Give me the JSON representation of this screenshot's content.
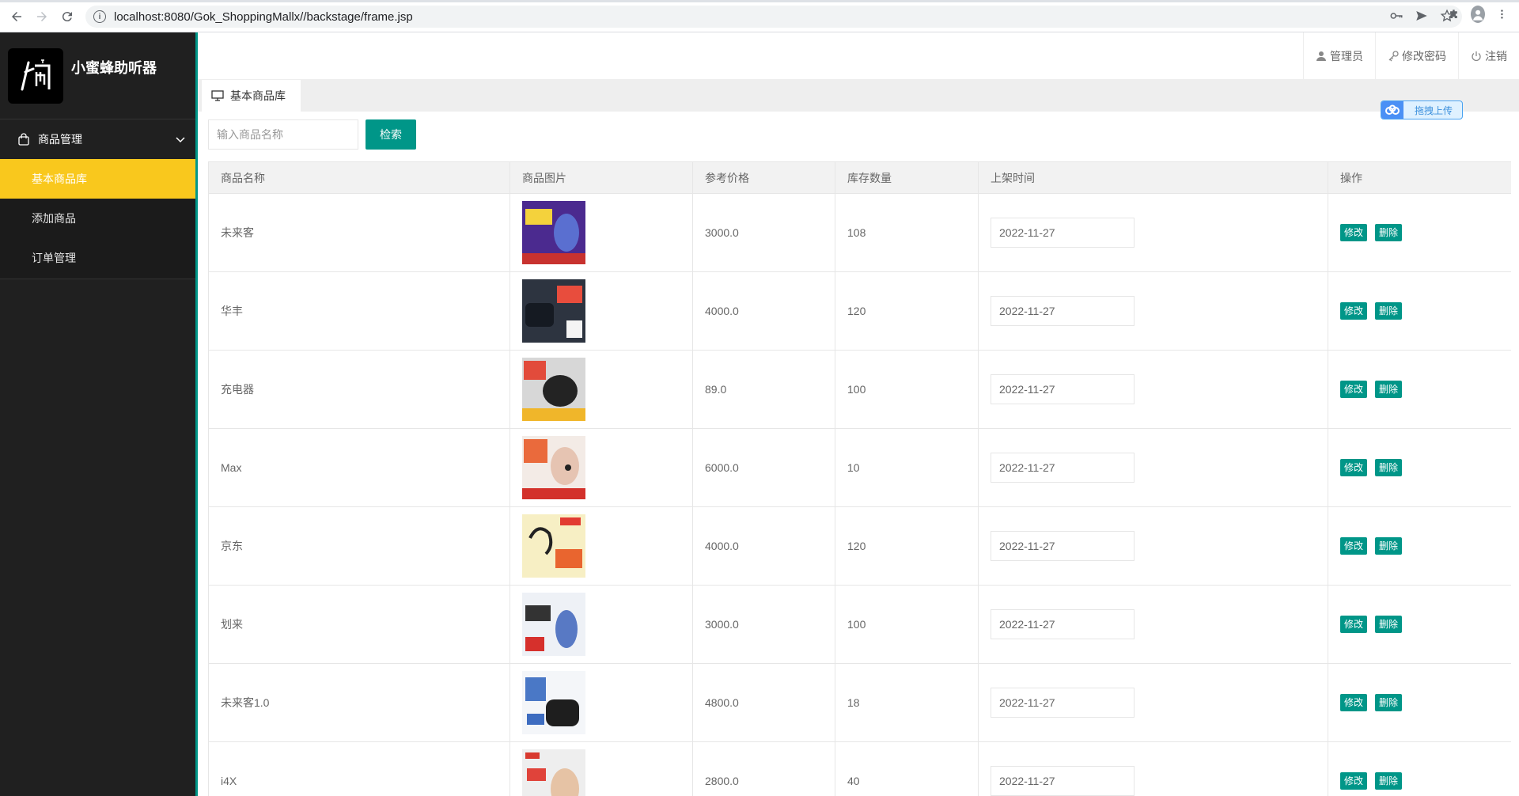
{
  "browser": {
    "url": "localhost:8080/Gok_ShoppingMallx//backstage/frame.jsp"
  },
  "sidebar": {
    "logo_title": "小蜜蜂助听器",
    "group_label": "商品管理",
    "items": [
      {
        "label": "基本商品库",
        "active": true
      },
      {
        "label": "添加商品",
        "active": false
      },
      {
        "label": "订单管理",
        "active": false
      }
    ]
  },
  "header": {
    "admin": "管理员",
    "change_password": "修改密码",
    "logout": "注销"
  },
  "tab": {
    "label": "基本商品库"
  },
  "upload": {
    "label": "拖拽上传"
  },
  "search": {
    "placeholder": "输入商品名称",
    "button": "检索"
  },
  "table": {
    "headers": [
      "商品名称",
      "商品图片",
      "参考价格",
      "库存数量",
      "上架时间",
      "操作"
    ],
    "edit_label": "修改",
    "delete_label": "删除",
    "rows": [
      {
        "name": "未来客",
        "price": "3000.0",
        "stock": "108",
        "date": "2022-11-27"
      },
      {
        "name": "华丰",
        "price": "4000.0",
        "stock": "120",
        "date": "2022-11-27"
      },
      {
        "name": "充电器",
        "price": "89.0",
        "stock": "100",
        "date": "2022-11-27"
      },
      {
        "name": "Max",
        "price": "6000.0",
        "stock": "10",
        "date": "2022-11-27"
      },
      {
        "name": "京东",
        "price": "4000.0",
        "stock": "120",
        "date": "2022-11-27"
      },
      {
        "name": "划来",
        "price": "3000.0",
        "stock": "100",
        "date": "2022-11-27"
      },
      {
        "name": "未来客1.0",
        "price": "4800.0",
        "stock": "18",
        "date": "2022-11-27"
      },
      {
        "name": "i4X",
        "price": "2800.0",
        "stock": "40",
        "date": "2022-11-27"
      }
    ]
  }
}
